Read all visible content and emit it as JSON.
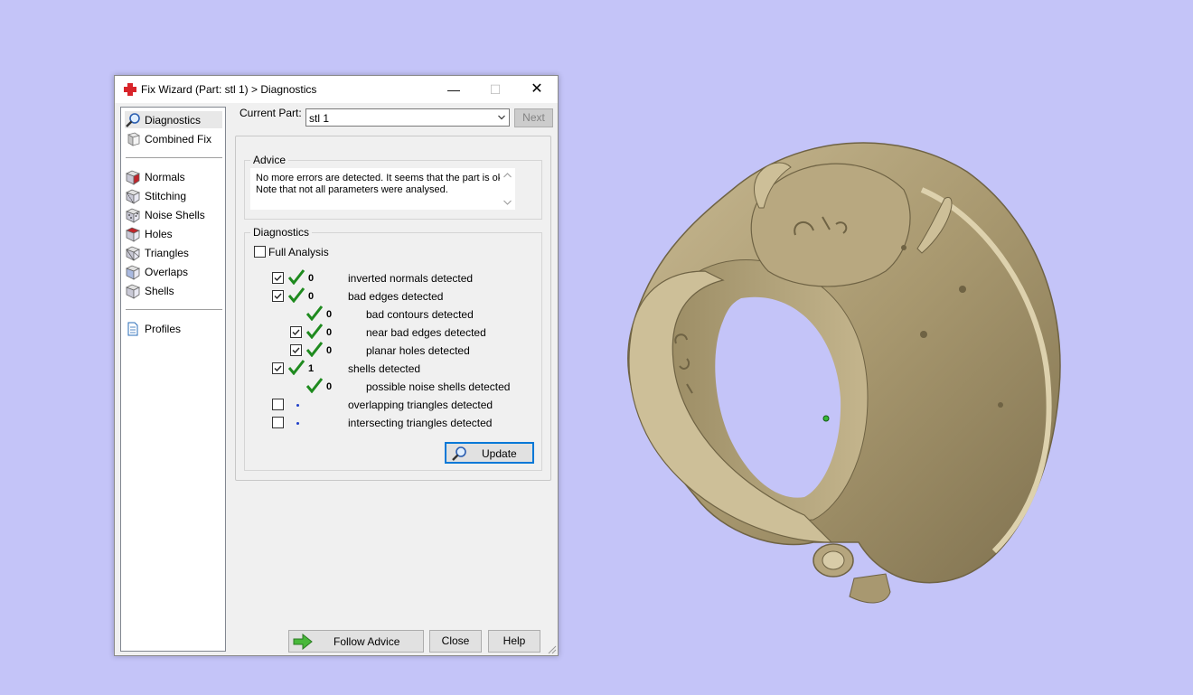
{
  "window": {
    "title": "Fix Wizard (Part: stl 1) > Diagnostics",
    "min_glyph": "—",
    "max_glyph": "☐",
    "close_glyph": "✕"
  },
  "sidebar": {
    "items": [
      {
        "label": "Diagnostics",
        "icon": "magnifier-icon",
        "selected": true
      },
      {
        "label": "Combined Fix",
        "icon": "combined-fix-icon"
      },
      {
        "label": "Normals",
        "icon": "normals-cube-icon"
      },
      {
        "label": "Stitching",
        "icon": "stitching-cube-icon"
      },
      {
        "label": "Noise Shells",
        "icon": "noise-shells-cube-icon"
      },
      {
        "label": "Holes",
        "icon": "holes-cube-icon"
      },
      {
        "label": "Triangles",
        "icon": "triangles-cube-icon"
      },
      {
        "label": "Overlaps",
        "icon": "overlaps-cube-icon"
      },
      {
        "label": "Shells",
        "icon": "shells-cube-icon"
      },
      {
        "label": "Profiles",
        "icon": "profiles-document-icon"
      }
    ]
  },
  "current_part": {
    "label": "Current Part:",
    "value": "stl 1"
  },
  "next_label": "Next",
  "advice": {
    "title": "Advice",
    "line1": "No more errors are detected. It seems that the part is ok.",
    "line2": "Note that not all parameters were analysed."
  },
  "diagnostics": {
    "title": "Diagnostics",
    "full_analysis": {
      "label": "Full Analysis",
      "checked": false
    },
    "rows": [
      {
        "checkbox": true,
        "checked": true,
        "status": "ok",
        "count": "0",
        "label": "inverted normals detected",
        "indent": 0
      },
      {
        "checkbox": true,
        "checked": true,
        "status": "ok",
        "count": "0",
        "label": "bad edges detected",
        "indent": 0
      },
      {
        "checkbox": false,
        "checked": false,
        "status": "ok",
        "count": "0",
        "label": "bad contours detected",
        "indent": 1
      },
      {
        "checkbox": true,
        "checked": true,
        "status": "ok",
        "count": "0",
        "label": "near bad edges detected",
        "indent": 1
      },
      {
        "checkbox": true,
        "checked": true,
        "status": "ok",
        "count": "0",
        "label": "planar holes detected",
        "indent": 1
      },
      {
        "checkbox": true,
        "checked": true,
        "status": "ok",
        "count": "1",
        "label": "shells detected",
        "indent": 0
      },
      {
        "checkbox": false,
        "checked": false,
        "status": "ok",
        "count": "0",
        "label": "possible noise shells detected",
        "indent": 1
      },
      {
        "checkbox": true,
        "checked": false,
        "status": "pending",
        "count": "",
        "label": "overlapping triangles detected",
        "indent": 0
      },
      {
        "checkbox": true,
        "checked": false,
        "status": "pending",
        "count": "",
        "label": "intersecting triangles detected",
        "indent": 0
      }
    ]
  },
  "buttons": {
    "update": "Update",
    "follow_advice": "Follow Advice",
    "close": "Close",
    "help": "Help"
  },
  "colors": {
    "background": "#c4c4f8",
    "ring": "#b5a57e",
    "check_green": "#1e8a1e",
    "accent": "#0078d7"
  }
}
